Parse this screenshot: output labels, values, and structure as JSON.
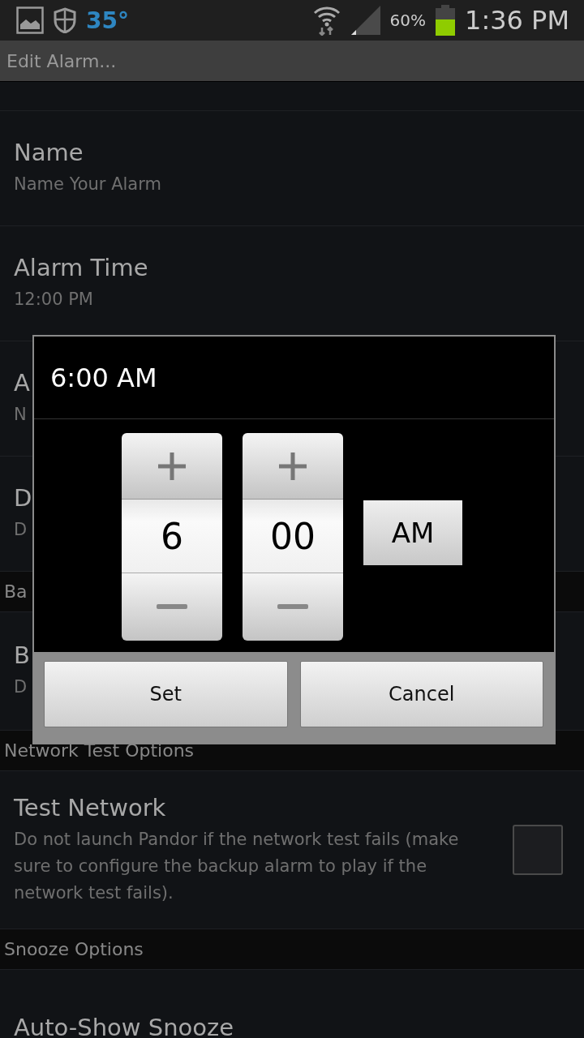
{
  "status_bar": {
    "temperature": "35°",
    "battery": "60%",
    "time": "1:36 PM"
  },
  "title_bar": {
    "title": "Edit Alarm..."
  },
  "settings": [
    {
      "kind": "item",
      "title": "Name",
      "subtitle": "Name Your Alarm"
    },
    {
      "kind": "item",
      "title": "Alarm Time",
      "subtitle": "12:00 PM"
    },
    {
      "kind": "item",
      "title": "A",
      "subtitle": "N"
    },
    {
      "kind": "item",
      "title": "D",
      "subtitle": "D"
    },
    {
      "kind": "header",
      "title": "Ba"
    },
    {
      "kind": "item",
      "title": "B",
      "subtitle": "D"
    },
    {
      "kind": "header",
      "title": "Network Test Options"
    },
    {
      "kind": "item",
      "title": "Test Network",
      "subtitle": "Do not launch Pandor if the network test fails (make sure to configure the backup alarm to play if the network test fails).",
      "checked": false
    },
    {
      "kind": "header",
      "title": "Snooze Options"
    },
    {
      "kind": "item",
      "title": "Auto-Show Snooze"
    }
  ],
  "dialog": {
    "title": "6:00 AM",
    "hour": "6",
    "minute": "00",
    "ampm": "AM",
    "buttons": [
      "Set",
      "Cancel"
    ]
  }
}
